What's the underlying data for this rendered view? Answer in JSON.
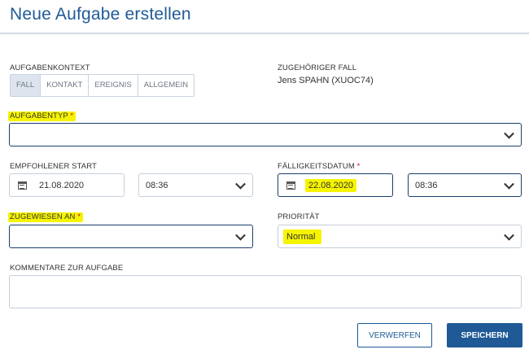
{
  "header": {
    "title": "Neue Aufgabe erstellen"
  },
  "context": {
    "label": "AUFGABENKONTEXT",
    "options": [
      "FALL",
      "KONTAKT",
      "EREIGNIS",
      "ALLGEMEIN"
    ],
    "selected": "FALL"
  },
  "case": {
    "label": "ZUGEHÖRIGER FALL",
    "value": "Jens SPAHN (XUOC74)"
  },
  "task_type": {
    "label": "AUFGABENTYP",
    "required_mark": "*",
    "value": ""
  },
  "recommended_start": {
    "label": "EMPFOHLENER START",
    "date": "21.08.2020",
    "time": "08:36"
  },
  "due_date": {
    "label": "FÄLLIGKEITSDATUM",
    "required_mark": "*",
    "date": "22.08.2020",
    "time": "08:36"
  },
  "assigned_to": {
    "label": "ZUGEWIESEN AN",
    "required_mark": "*",
    "value": ""
  },
  "priority": {
    "label": "PRIORITÄT",
    "value": "Normal"
  },
  "comments": {
    "label": "KOMMENTARE ZUR AUFGABE",
    "value": ""
  },
  "actions": {
    "discard": "VERWERFEN",
    "save": "SPEICHERN"
  },
  "colors": {
    "accent": "#1f5a96",
    "highlight": "#f6f400",
    "required": "#d0021b"
  }
}
